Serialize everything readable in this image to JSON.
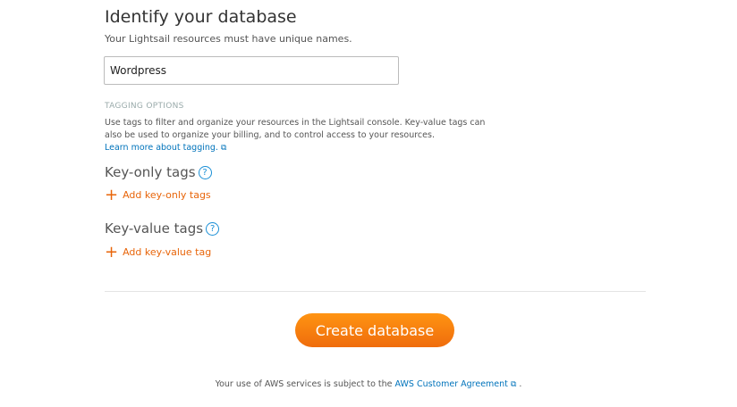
{
  "title": "Identify your database",
  "subtitle": "Your Lightsail resources must have unique names.",
  "name_input": {
    "value": "Wordpress"
  },
  "tagging": {
    "label": "TAGGING OPTIONS",
    "description": "Use tags to filter and organize your resources in the Lightsail console. Key-value tags can also be used to organize your billing, and to control access to your resources.",
    "learn_more": "Learn more about tagging.",
    "key_only_heading": "Key-only tags",
    "add_key_only": "Add key-only tags",
    "key_value_heading": "Key-value tags",
    "add_key_value": "Add key-value tag"
  },
  "create_button": "Create database",
  "footer": {
    "text": "Your use of AWS services is subject to the",
    "link": "AWS Customer Agreement",
    "end": "."
  },
  "icons": {
    "help": "?",
    "plus": "+",
    "external": "⧉"
  }
}
